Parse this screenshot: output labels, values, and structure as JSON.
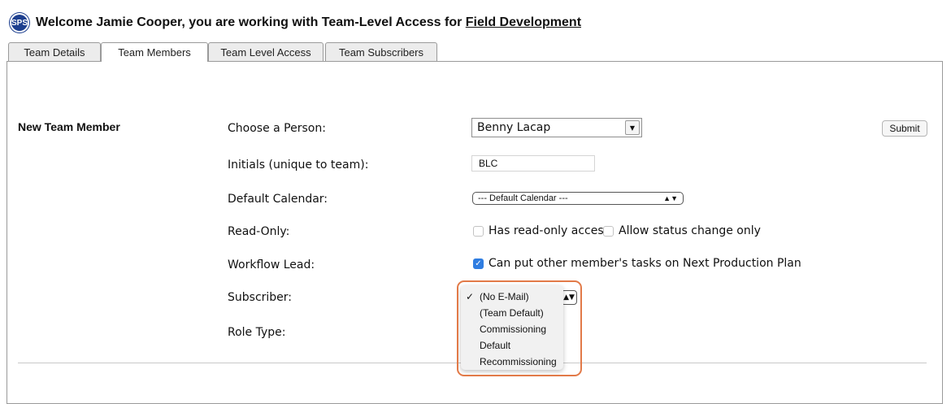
{
  "header": {
    "logo_text": "SPS",
    "welcome_prefix": "Welcome Jamie Cooper, you are working with Team-Level Access for ",
    "team_link": "Field Development"
  },
  "tabs": [
    {
      "label": "Team Details"
    },
    {
      "label": "Team Members"
    },
    {
      "label": "Team Level Access"
    },
    {
      "label": "Team Subscribers"
    }
  ],
  "form": {
    "section_title": "New Team Member",
    "choose_person_label": "Choose a Person:",
    "choose_person_value": "Benny Lacap",
    "submit_label": "Submit",
    "initials_label": "Initials (unique to team):",
    "initials_value": "BLC",
    "calendar_label": "Default Calendar:",
    "calendar_value": "--- Default Calendar ---",
    "readonly_label": "Read-Only:",
    "readonly_option_1": "Has read-only access",
    "readonly_option_2": "Allow status change only",
    "workflow_label": "Workflow Lead:",
    "workflow_option": "Can put other member's tasks on Next Production Plan",
    "subscriber_label": "Subscriber:",
    "role_label": "Role Type:"
  },
  "subscriber_dropdown": {
    "options": [
      "(No E-Mail)",
      "(Team Default)",
      "Commissioning",
      "Default",
      "Recommissioning"
    ],
    "selected": "(No E-Mail)"
  },
  "colors": {
    "highlight": "#e27a48",
    "checkbox_checked": "#2f7de1",
    "logo": "#1d3f8f"
  }
}
